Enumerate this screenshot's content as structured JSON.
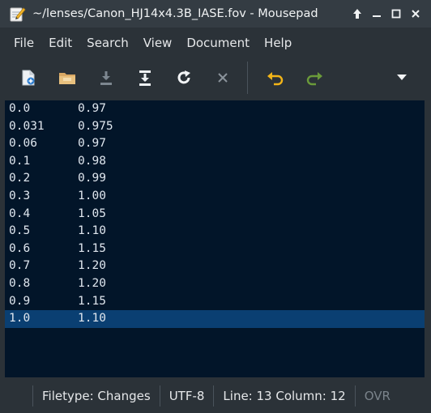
{
  "window": {
    "title": "~/lenses/Canon_HJ14x4.3B_IASE.fov - Mousepad"
  },
  "menu": {
    "items": [
      "File",
      "Edit",
      "Search",
      "View",
      "Document",
      "Help"
    ]
  },
  "toolbar": {
    "icons": [
      "new-document-icon",
      "open-folder-icon",
      "save-icon",
      "save-as-icon",
      "reload-icon",
      "close-icon",
      "undo-icon",
      "redo-icon",
      "overflow-menu-icon"
    ],
    "colors": {
      "undo": "#f2b418",
      "redo": "#6a9a3a"
    }
  },
  "editor": {
    "lines": [
      {
        "x": "0.0",
        "y": "0.97"
      },
      {
        "x": "0.031",
        "y": "0.975"
      },
      {
        "x": "0.06",
        "y": "0.97"
      },
      {
        "x": "0.1",
        "y": "0.98"
      },
      {
        "x": "0.2",
        "y": "0.99"
      },
      {
        "x": "0.3",
        "y": "1.00"
      },
      {
        "x": "0.4",
        "y": "1.05"
      },
      {
        "x": "0.5",
        "y": "1.10"
      },
      {
        "x": "0.6",
        "y": "1.15"
      },
      {
        "x": "0.7",
        "y": "1.20"
      },
      {
        "x": "0.8",
        "y": "1.20"
      },
      {
        "x": "0.9",
        "y": "1.15"
      },
      {
        "x": "1.0",
        "y": "1.10"
      }
    ],
    "current_line": 13,
    "colors": {
      "background": "#021529",
      "highlight": "#0a3f72"
    }
  },
  "status": {
    "filetype": "Filetype: Changes",
    "encoding": "UTF-8",
    "position": "Line: 13 Column: 12",
    "mode": "OVR"
  }
}
